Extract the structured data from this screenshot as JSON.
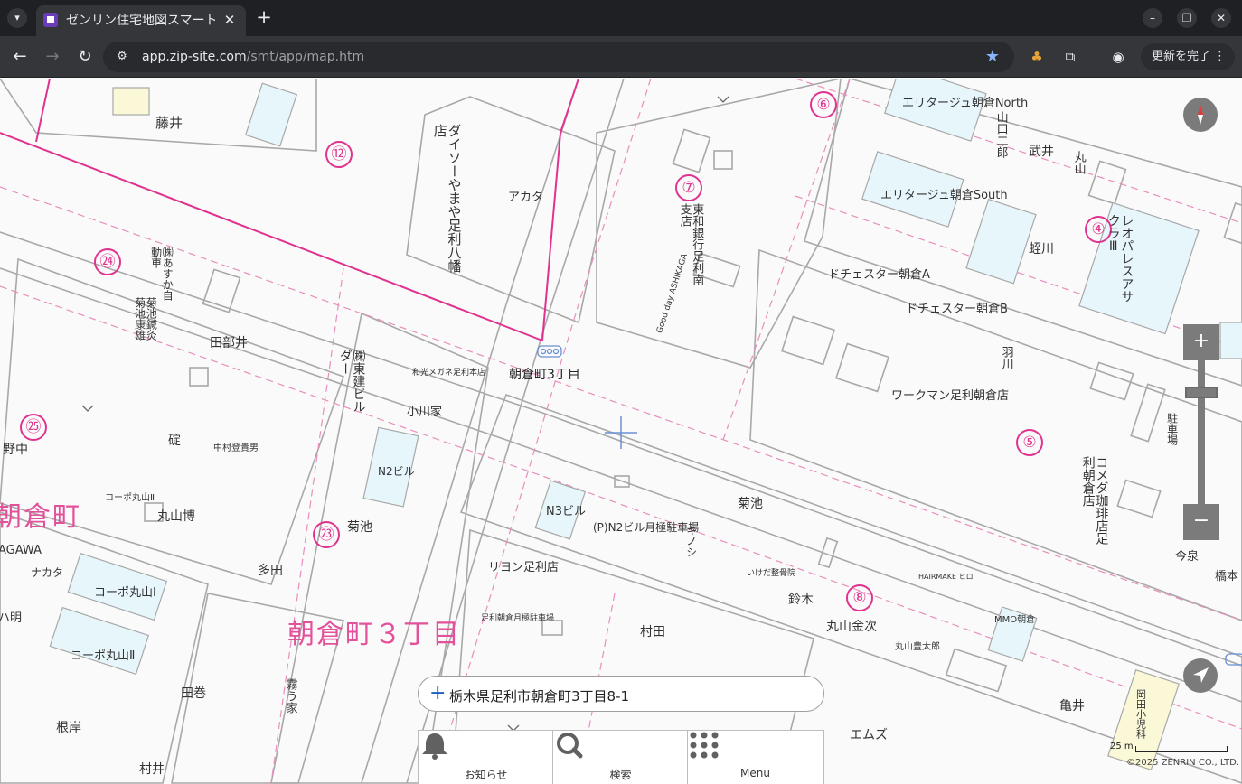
{
  "browser": {
    "tab_title": "ゼンリン住宅地図スマートフォン版",
    "url_host": "app.zip-site.com",
    "url_path": "/smt/app/map.htm",
    "update_label": "更新を完了"
  },
  "map": {
    "areas": [
      "朝倉町３丁目",
      "朝倉町"
    ],
    "place_label": "朝倉町3丁目",
    "block_numbers": [
      "⑫",
      "⑥",
      "⑦",
      "④",
      "㉔",
      "㉕",
      "⑤",
      "㉓",
      "⑧"
    ],
    "buildings": {
      "fujii": "藤井",
      "yamaya": "やまや足利八幡店",
      "daiso": "ダイソーやまや足利八幡店",
      "akata": "アカタ",
      "toho_bank": "東和銀行足利南支店",
      "good_day": "Good day ASHIKAGA",
      "ashika_car": "㈱あすか自動車",
      "kikuchi_shinsatsu": "菊池鍼灸菊池康雄",
      "tabei": "田部井",
      "toho_bldg": "㈱東建ビルダー",
      "wako": "和光メガネ足利本店",
      "ogawa": "小川家",
      "n2_bldg": "N2ビル",
      "hidetake": "碇",
      "nakamura": "中村登貴男",
      "nonaka": "野中",
      "maruyama_flat": "丸山博",
      "tada": "多田",
      "kikuchi": "菊池",
      "kikuchi2": "菊池",
      "n3_bldg": "N3ビル",
      "n2_parking": "(P)N2ビル月極駐車場",
      "kinoshita": "キノシ",
      "lyon": "リヨン足利店",
      "coop1": "コーポ丸山Ⅰ",
      "coop2": "コーポ丸山Ⅱ",
      "coop3": "コーポ丸山Ⅲ",
      "nakata": "ナカタ",
      "taguchi": "田巻",
      "negishi": "根岸",
      "murata": "村田",
      "muratai": "村井",
      "ashikaga_parking": "足利朝倉月極駐車場",
      "ikeda": "いけだ整骨院",
      "suzuki": "鈴木",
      "maruyama_kinji": "丸山金次",
      "maruyama_isaburo": "丸山豊太郎",
      "hairmake": "HAIRMAKE ヒロ",
      "mmo": "MMO朝倉",
      "kamei": "亀井",
      "ems": "エムズ",
      "erita_north": "エリタージュ朝倉North",
      "erita_south": "エリタージュ朝倉South",
      "takeei": "武井",
      "maruyama": "丸山",
      "yamaguchi": "山口二郎",
      "hiyakawa": "蛭川",
      "leopalace": "レオパレスアサクラⅢ",
      "dorchester_a": "ドチェスター朝倉A",
      "dorchester_b": "ドチェスター朝倉B",
      "workman": "ワークマン足利朝倉店",
      "ukawa": "羽川",
      "komeda": "コメダ珈琲店足利朝倉店",
      "imaizumi": "今泉",
      "hashimoto": "橋本",
      "parking": "駐車場",
      "okada": "岡田小児科",
      "ryokan": "霧う家",
      "ashika_gawa": "AGAWA",
      "ham": "ハ明"
    }
  },
  "address": {
    "text": "栃木県足利市朝倉町3丁目8-1"
  },
  "menu": {
    "items": [
      {
        "label": "お知らせ",
        "icon": "bell-icon"
      },
      {
        "label": "検索",
        "icon": "magnifier-icon"
      },
      {
        "label": "Menu",
        "icon": "grid-dots-icon"
      }
    ]
  },
  "scale": {
    "label": "25 m"
  },
  "copyright": "©2025 ZENRIN CO., LTD."
}
